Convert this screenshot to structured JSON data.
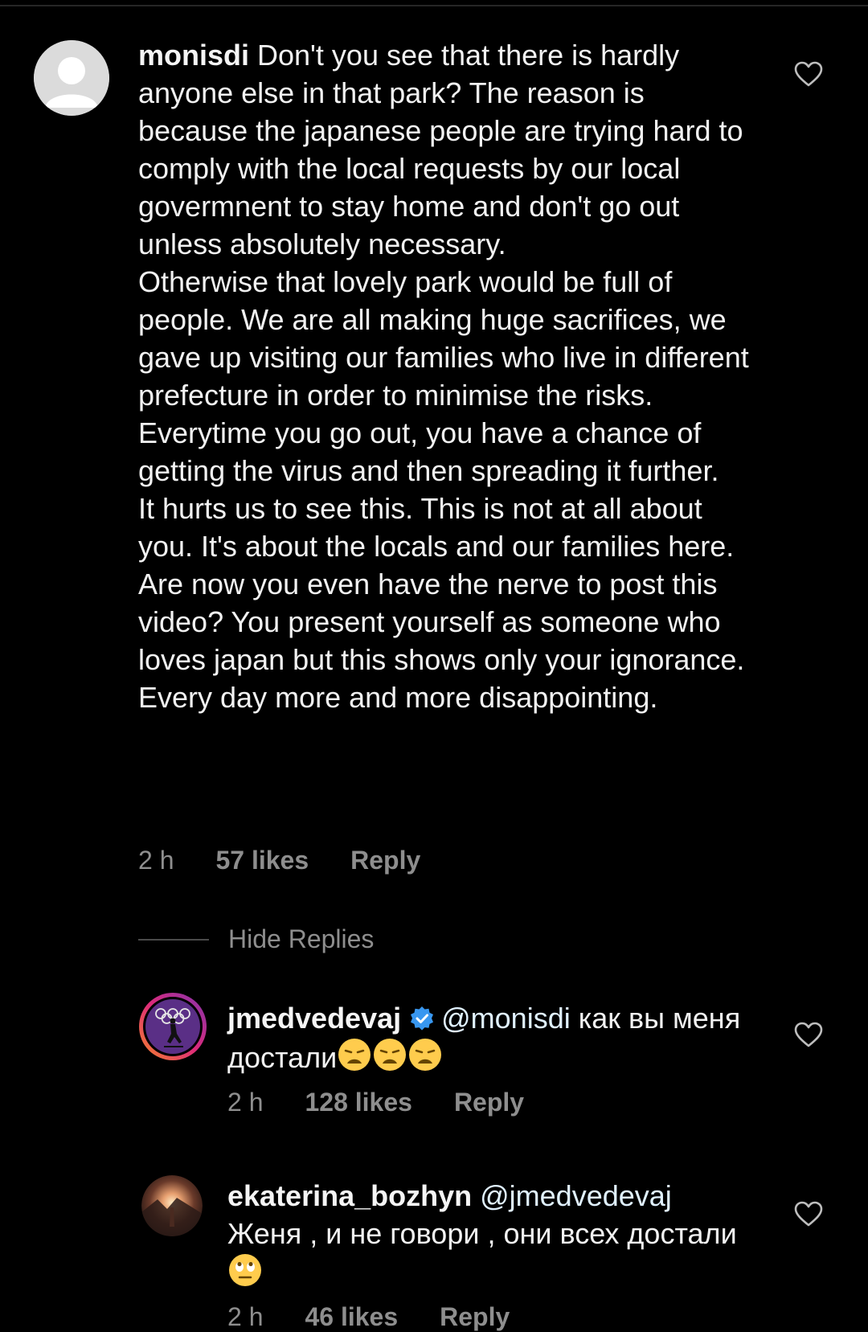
{
  "comments": [
    {
      "username": "monisdi",
      "mention": "",
      "body": " Don't you see that there is hardly anyone else in that park? The reason is because the japanese people are trying hard to comply with the local requests by our local govermnent to stay home and don't go out unless absolutely necessary.\nOtherwise that lovely park would be full of people. We are all making huge sacrifices, we gave up visiting our families who live in different prefecture in order to minimise the risks. Everytime you go out, you have a chance of getting the virus and then spreading it further.\nIt hurts us to see this. This is not at all about you. It's about the locals and our families here.\nAre now you even have the nerve to post this video? You present yourself as someone who loves japan but this shows only your ignorance.\nEvery day more and more disappointing.",
      "time": "2 h",
      "likes": "57 likes",
      "reply": "Reply",
      "avatar_icon": "default-avatar-icon"
    },
    {
      "username": "jmedvedevaj",
      "mention": "@monisdi",
      "body": " как вы меня достали",
      "time": "2 h",
      "likes": "128 likes",
      "reply": "Reply",
      "verified": true,
      "avatar_icon": "olympic-skater-avatar",
      "emoji_count": 3,
      "emoji_icon": "weary-face-emoji"
    },
    {
      "username": "ekaterina_bozhyn",
      "mention": "@jmedvedevaj",
      "body": "Женя , и не говори , они всех достали ",
      "time": "2 h",
      "likes": "46 likes",
      "reply": "Reply",
      "avatar_icon": "sunset-photo-avatar",
      "emoji_icon": "rolling-eyes-emoji"
    }
  ],
  "hide_replies_label": "Hide Replies",
  "colors": {
    "background": "#000000",
    "text": "#f2f2f2",
    "meta": "#8e8e8e",
    "verified": "#3897f0"
  }
}
